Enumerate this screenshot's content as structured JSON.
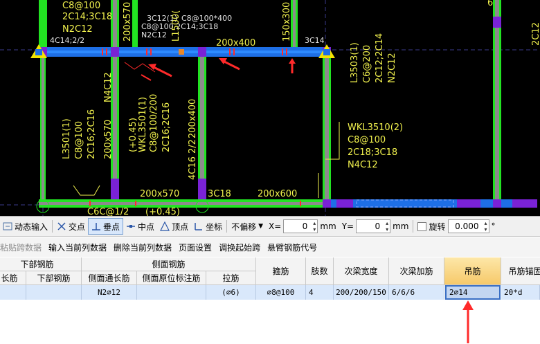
{
  "cad": {
    "labels": {
      "top_a": "C8@100",
      "top_b": "2C14;3C18",
      "top_c": "N2C12",
      "top_d": "4C14;2/2",
      "top_e": "3C12(1)",
      "top_e2": "C8@100*400",
      "top_f": "C8@100 2C14;3C18",
      "top_g": "N2C12",
      "vert_570": "200x570",
      "vert_500": "L1500(",
      "vert_300": "150x300",
      "beam_top": "200x400",
      "beam_3c14": "3C14",
      "l3503_a": "L3503(1)",
      "l3503_b": "C6@200",
      "l3503_c": "2C12;2C14",
      "l3503_d": "N2C12",
      "right_a": "2C12",
      "right_b": "6",
      "l3501_a": "L3501(1)",
      "l3501_b": "C8@100",
      "l3501_c": "2C16;2C16",
      "l3501_d": "200x570",
      "l3501_e": "N4C12",
      "wkl3501_a": "(+0.45)",
      "wkl3501_b": "WKL3501(1)",
      "wkl3501_c": "C8@100/200",
      "wkl3501_d": "2C16;2C16",
      "mid_a": "4C16 2/2",
      "mid_b": "200x400",
      "wkl3510_a": "WKL3510(2)",
      "wkl3510_b": "C8@100",
      "wkl3510_c": "2C18;3C18",
      "wkl3510_d": "N4C12",
      "bot_a": "200x570",
      "bot_b": "3C18",
      "bot_c": "200x600",
      "bot_d": "(+0.45)",
      "bot_e": "C6C@1/2"
    },
    "colors": {
      "background": "#000000",
      "beam_green": "#22e322",
      "beam_blue": "#1e6fe6",
      "column_purple": "#7a22d6",
      "text_yellow": "#f2f24e",
      "arrow_red": "#ff2a2a"
    }
  },
  "snapbar": {
    "dynamic_input": "动态输入",
    "intersection": "交点",
    "perpendicular": "垂点",
    "midpoint": "中点",
    "vertex": "顶点",
    "coordinate": "坐标",
    "offset_mode": "不偏移",
    "x_label": "X=",
    "x_value": "0",
    "x_unit": "mm",
    "y_label": "Y=",
    "y_value": "0",
    "y_unit": "mm",
    "rotate_label": "旋转",
    "rotate_value": "0.000",
    "degree": "°"
  },
  "table_toolbar": {
    "paste_span": "粘贴跨数据",
    "input_current_col": "输入当前列数据",
    "delete_current_col": "删除当前列数据",
    "page_setup": "页面设置",
    "swap_start_span": "调换起始跨",
    "cantilever_code": "悬臂钢筋代号"
  },
  "table": {
    "group_headers": {
      "bottom_rebar": "下部钢筋",
      "side_rebar": "侧面钢筋"
    },
    "sub_headers": {
      "long_rebar": "长筋",
      "bottom_rebar": "下部钢筋",
      "side_through_long": "侧面通长筋",
      "side_original_mark": "侧面原位标注筋",
      "tie_bar": "拉筋"
    },
    "columns": {
      "stirrup": "箍筋",
      "legs": "肢数",
      "secondary_beam_width": "次梁宽度",
      "secondary_beam_extra": "次梁加筋",
      "hanger_bar": "吊筋",
      "hanger_anchor": "吊筋锚固"
    },
    "row": {
      "long_rebar": "",
      "bottom_rebar": "",
      "side_through_long": "N2⌀12",
      "side_original_mark": "",
      "tie_bar": "(⌀6)",
      "stirrup": "⌀8@100",
      "legs": "4",
      "secondary_beam_width": "200/200/150",
      "secondary_beam_extra": "6/6/6",
      "hanger_bar": "2⌀14",
      "hanger_anchor": "20*d"
    }
  }
}
